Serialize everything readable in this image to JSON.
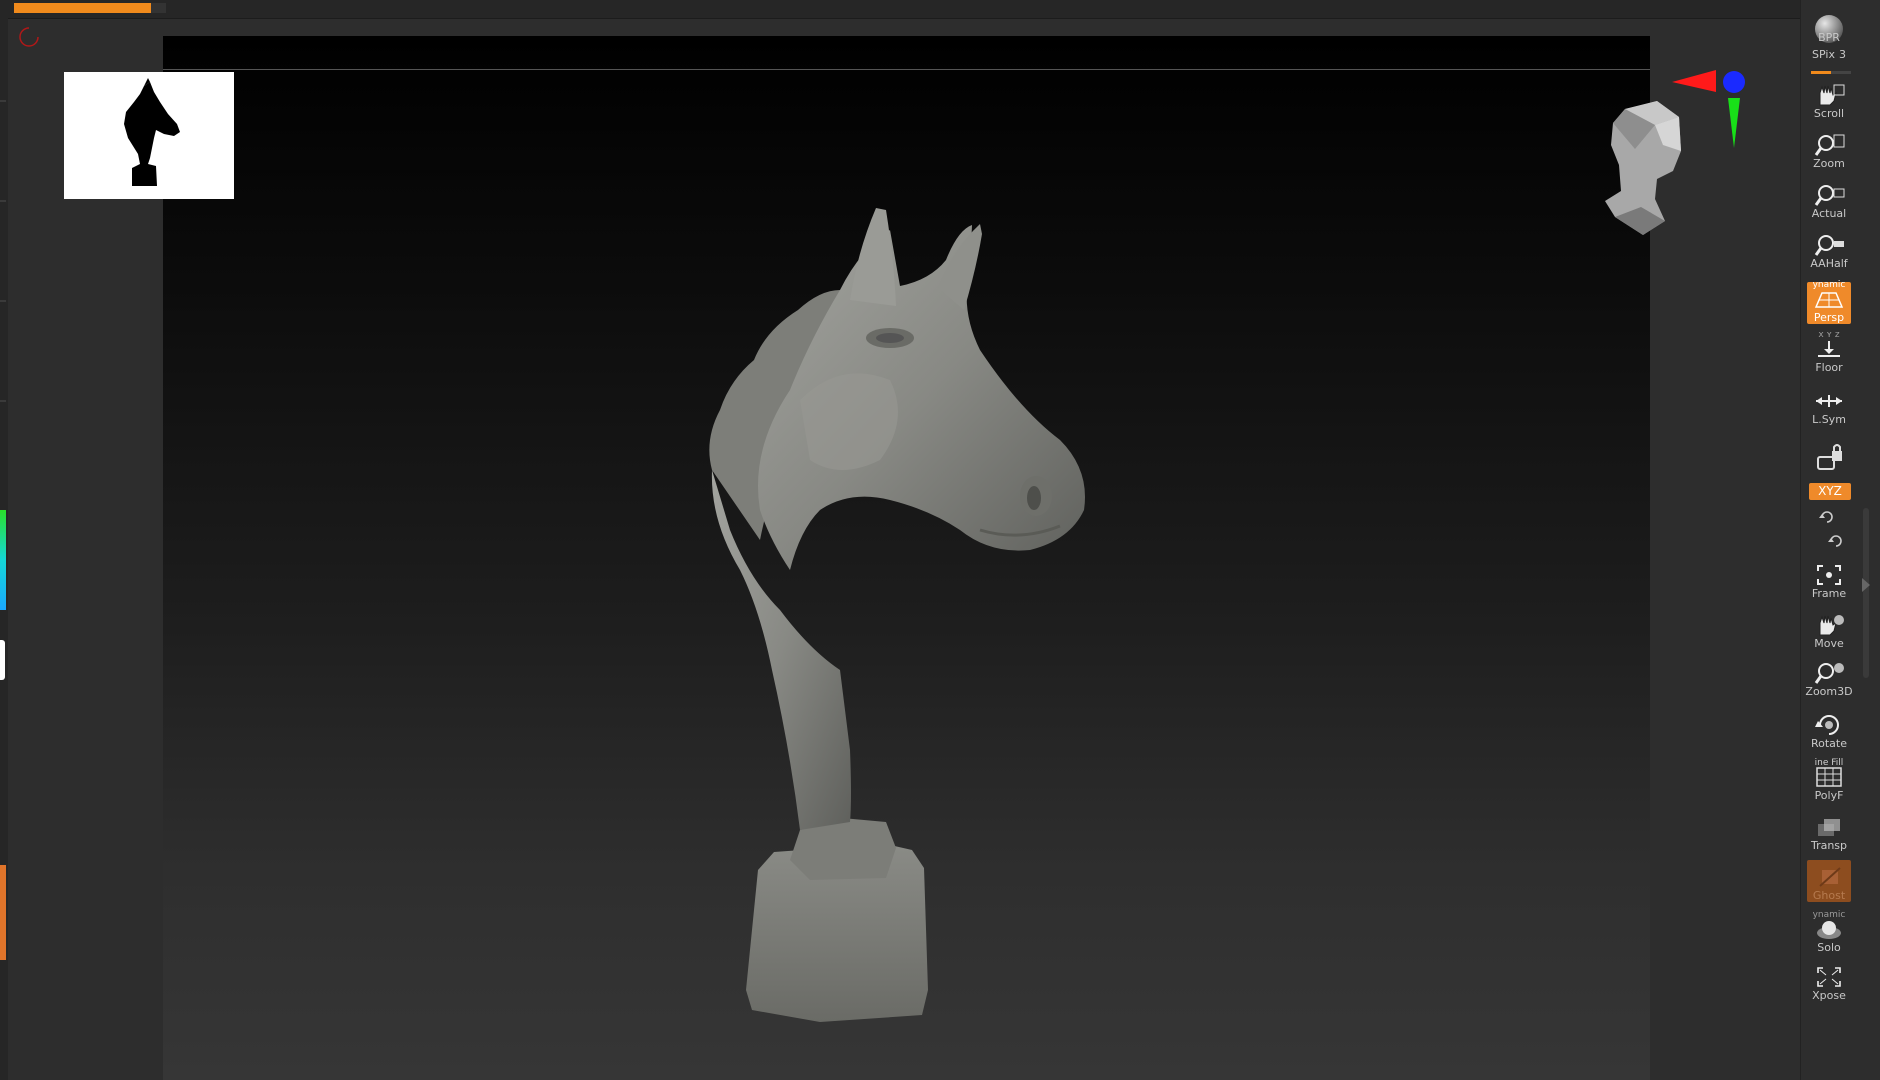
{
  "progress": {
    "fraction": 0.9
  },
  "thumbnail": {
    "icon": "horse-head-silhouette"
  },
  "nav_cube": {
    "icon": "head-navigation-cube"
  },
  "gizmo": {
    "icon": "xyz-axis-gizmo",
    "x_color": "#ff1a1a",
    "y_color": "#18e018",
    "z_color": "#1a2aff"
  },
  "shelf": {
    "bpr": {
      "label": "BPR"
    },
    "spix": {
      "label": "SPix",
      "value": "3",
      "fraction": 0.5
    },
    "scroll": {
      "label": "Scroll"
    },
    "zoom": {
      "label": "Zoom"
    },
    "actual": {
      "label": "Actual"
    },
    "aahalf": {
      "label": "AAHalf"
    },
    "persp": {
      "label": "Persp",
      "sup": "ynamic"
    },
    "floor": {
      "label": "Floor",
      "sup": "x ʏ z"
    },
    "lsym": {
      "label": "L.Sym"
    },
    "lock": {
      "icon": "lock-camera-icon"
    },
    "xyz": {
      "label": "XYZ"
    },
    "frame": {
      "label": "Frame"
    },
    "move": {
      "label": "Move"
    },
    "zoom3d": {
      "label": "Zoom3D"
    },
    "rotate": {
      "label": "Rotate"
    },
    "polyf": {
      "label": "PolyF",
      "sup": "ine Fill"
    },
    "transp": {
      "label": "Transp"
    },
    "ghost": {
      "label": "Ghost"
    },
    "solo": {
      "label": "Solo",
      "sup": "ynamic"
    },
    "xpose": {
      "label": "Xpose"
    }
  },
  "colors": {
    "accent": "#ef8a2a",
    "shelf_bg": "#2d2d2d",
    "model": "#8b8c88"
  }
}
